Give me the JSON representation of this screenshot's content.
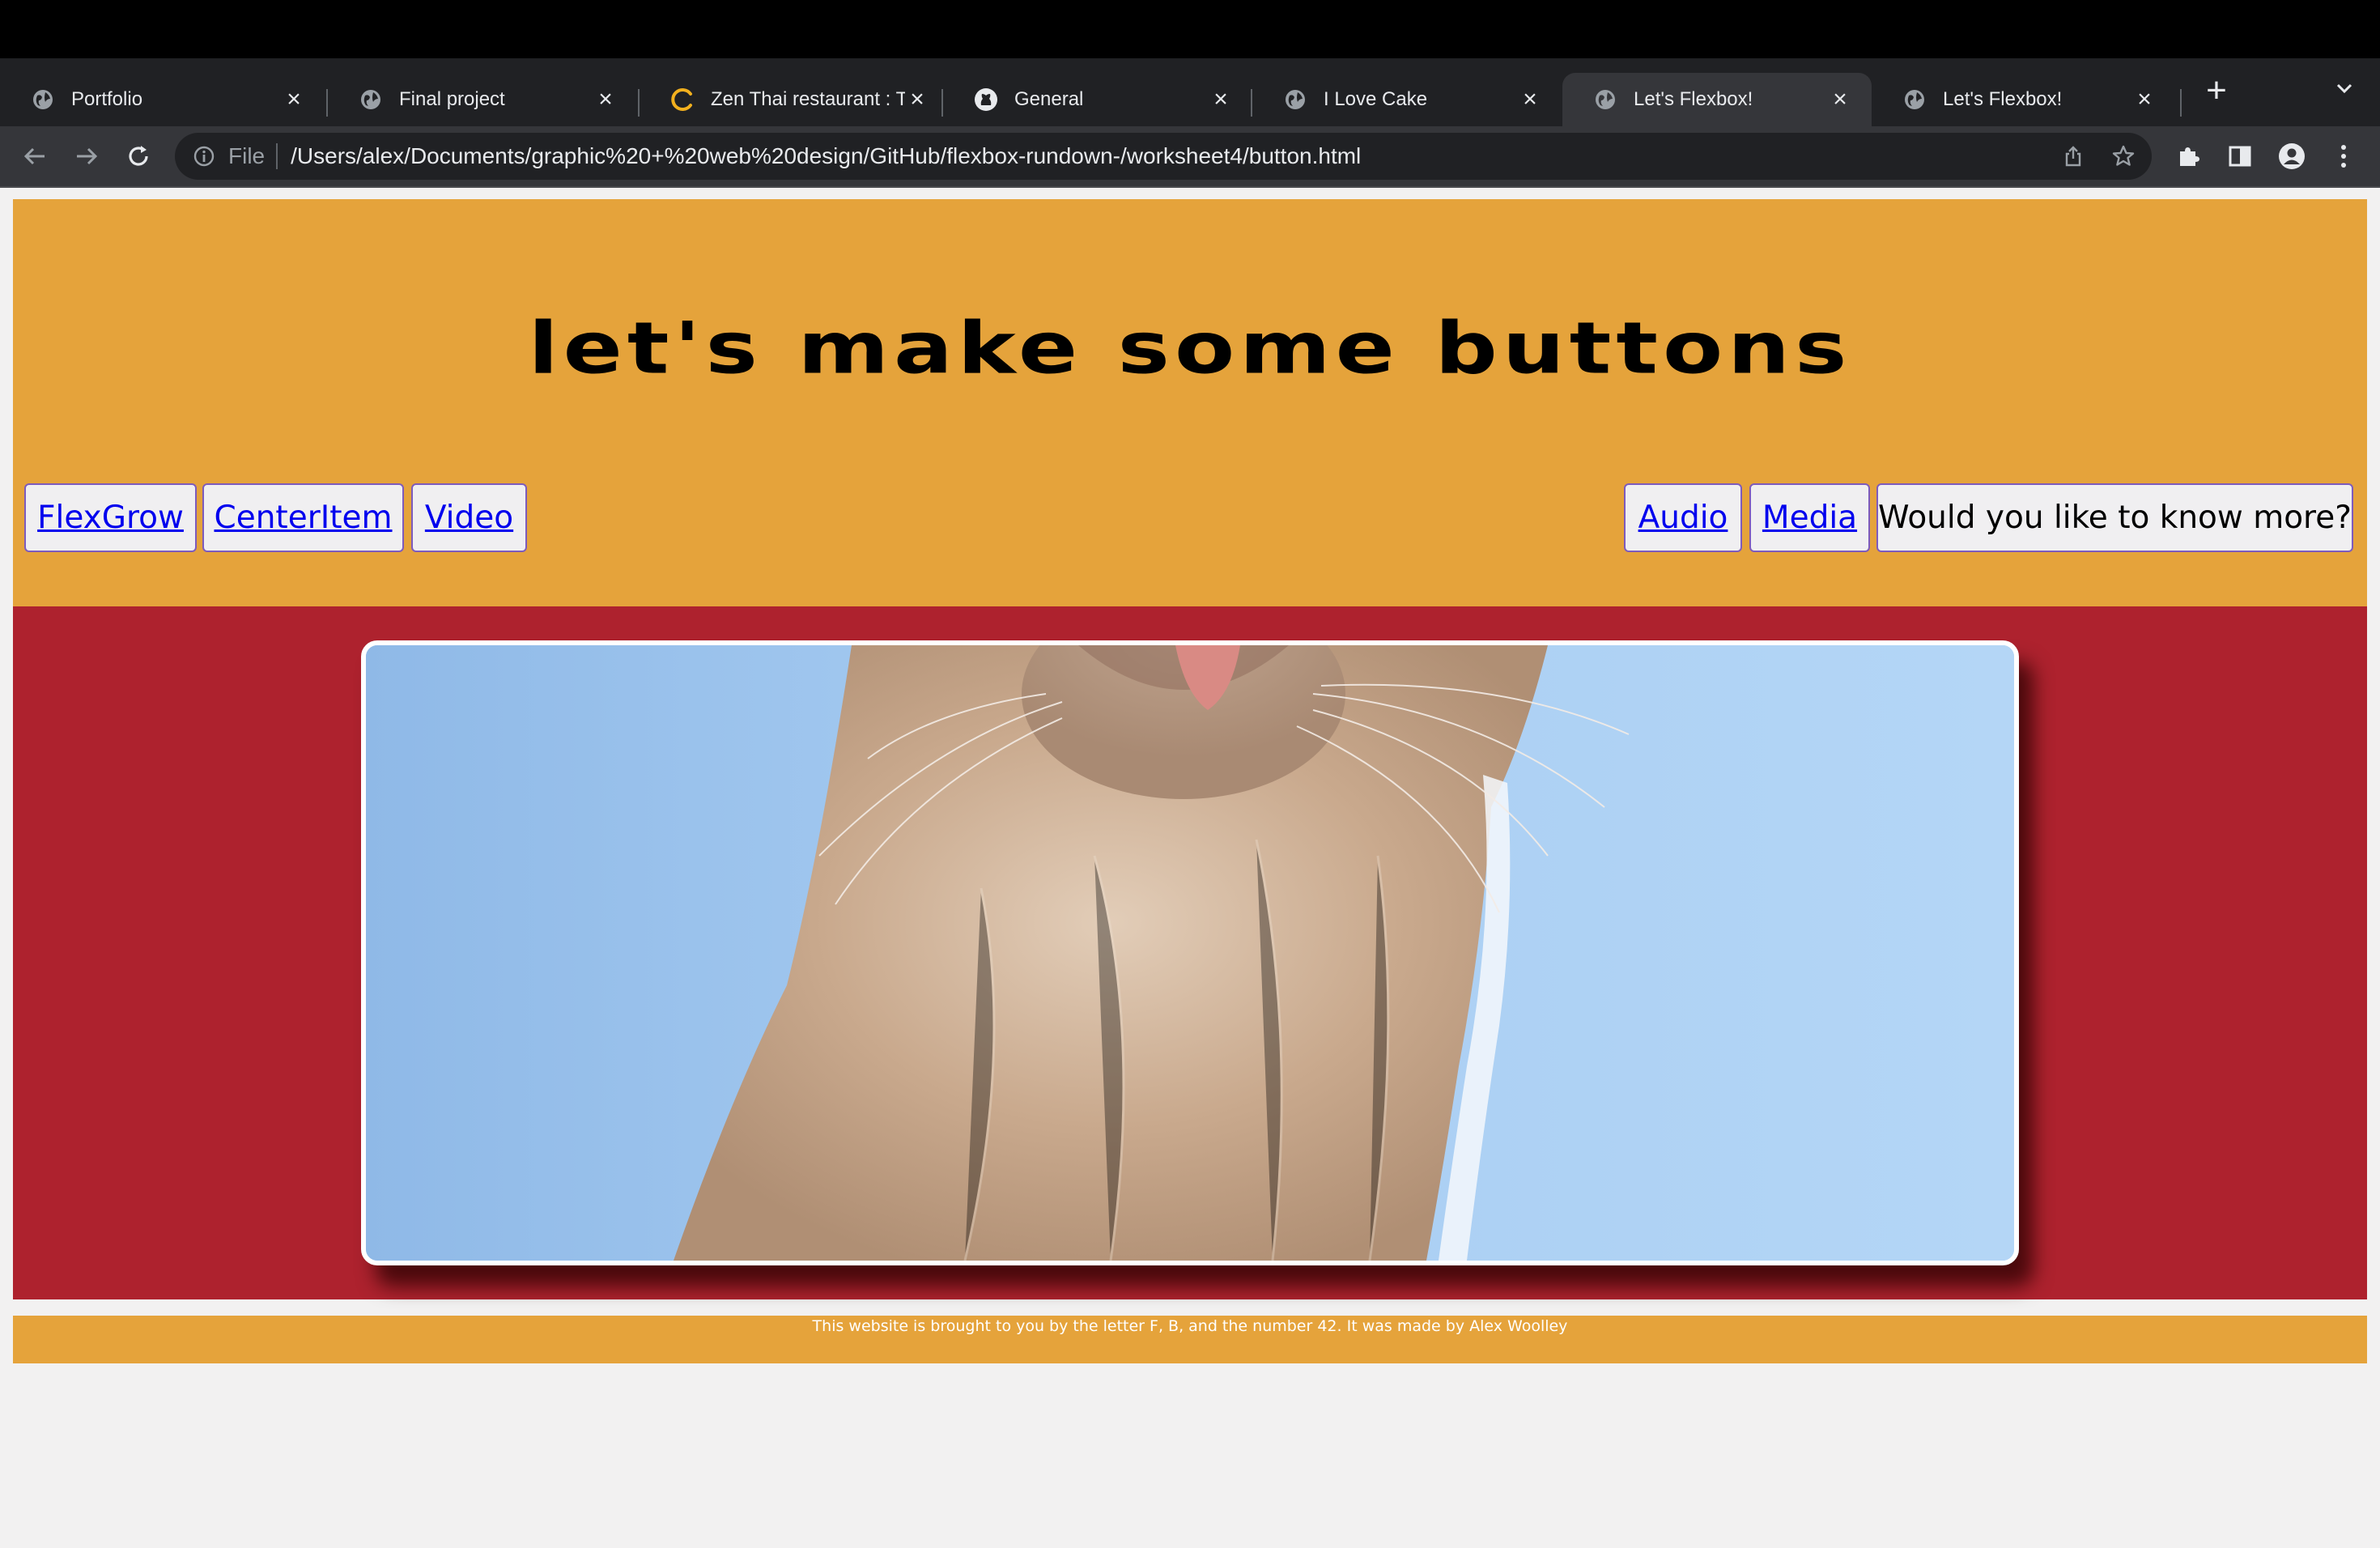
{
  "browser": {
    "tabs": [
      {
        "title": "Portfolio",
        "icon": "globe-icon",
        "active": false
      },
      {
        "title": "Final project",
        "icon": "globe-icon",
        "active": false
      },
      {
        "title": "Zen Thai restaurant : T",
        "icon": "loading-spinner-icon",
        "active": false
      },
      {
        "title": "General",
        "icon": "github-icon",
        "active": false
      },
      {
        "title": "I Love Cake",
        "icon": "globe-icon",
        "active": false
      },
      {
        "title": "Let's Flexbox!",
        "icon": "globe-icon",
        "active": true
      },
      {
        "title": "Let's Flexbox!",
        "icon": "globe-icon",
        "active": false
      }
    ],
    "address_bar": {
      "scheme_label": "File",
      "url": "/Users/alex/Documents/graphic%20+%20web%20design/GitHub/flexbox-rundown-/worksheet4/button.html"
    }
  },
  "page": {
    "title": "let's make some buttons",
    "buttons_left": [
      {
        "label": "FlexGrow",
        "style": "link"
      },
      {
        "label": "CenterItem",
        "style": "link"
      },
      {
        "label": "Video",
        "style": "link"
      }
    ],
    "buttons_right": [
      {
        "label": "Audio",
        "style": "link"
      },
      {
        "label": "Media",
        "style": "link"
      },
      {
        "label": "Would you like to know more?",
        "style": "plain"
      }
    ],
    "hero_image": {
      "subject": "close-up of a white kitten's chin and chest against a blue sky"
    },
    "footer_text": "This website is brought to you by the letter F, B, and the number 42. It was made by Alex Woolley"
  },
  "colors": {
    "header_bg": "#e5a33b",
    "hero_bg": "#ae222e",
    "footer_bg": "#e5a33b",
    "page_bg": "#f2f1f1",
    "link": "#0000ee",
    "button_border": "#7d5bbd"
  }
}
